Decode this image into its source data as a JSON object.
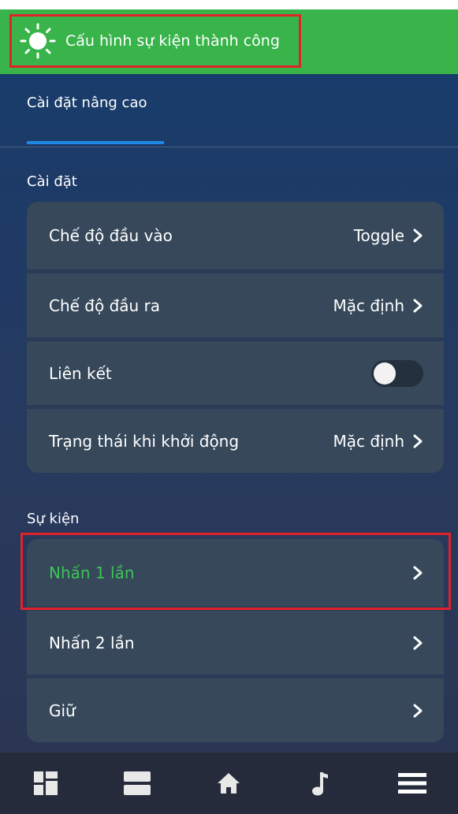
{
  "toast": {
    "message": "Cấu hình sự kiện thành công",
    "icon": "sun-icon",
    "color": "#38b44a"
  },
  "tab": {
    "label": "Cài đặt nâng cao"
  },
  "settings": {
    "title": "Cài đặt",
    "rows": [
      {
        "label": "Chế độ đầu vào",
        "value": "Toggle"
      },
      {
        "label": "Chế độ đầu ra",
        "value": "Mặc định"
      },
      {
        "label": "Liên kết",
        "toggle_on": false
      },
      {
        "label": "Trạng thái khi khởi động",
        "value": "Mặc định"
      }
    ]
  },
  "events": {
    "title": "Sự kiện",
    "rows": [
      {
        "label": "Nhấn 1 lần",
        "highlighted": true
      },
      {
        "label": "Nhấn 2 lần"
      },
      {
        "label": "Giữ"
      }
    ]
  },
  "bottom_nav": {
    "items": [
      "dashboard-icon",
      "rooms-icon",
      "home-icon",
      "music-icon",
      "menu-icon"
    ]
  },
  "colors": {
    "accent_green": "#3ec45a",
    "highlight_red": "#e0222a",
    "tab_blue": "#1e88e5"
  }
}
